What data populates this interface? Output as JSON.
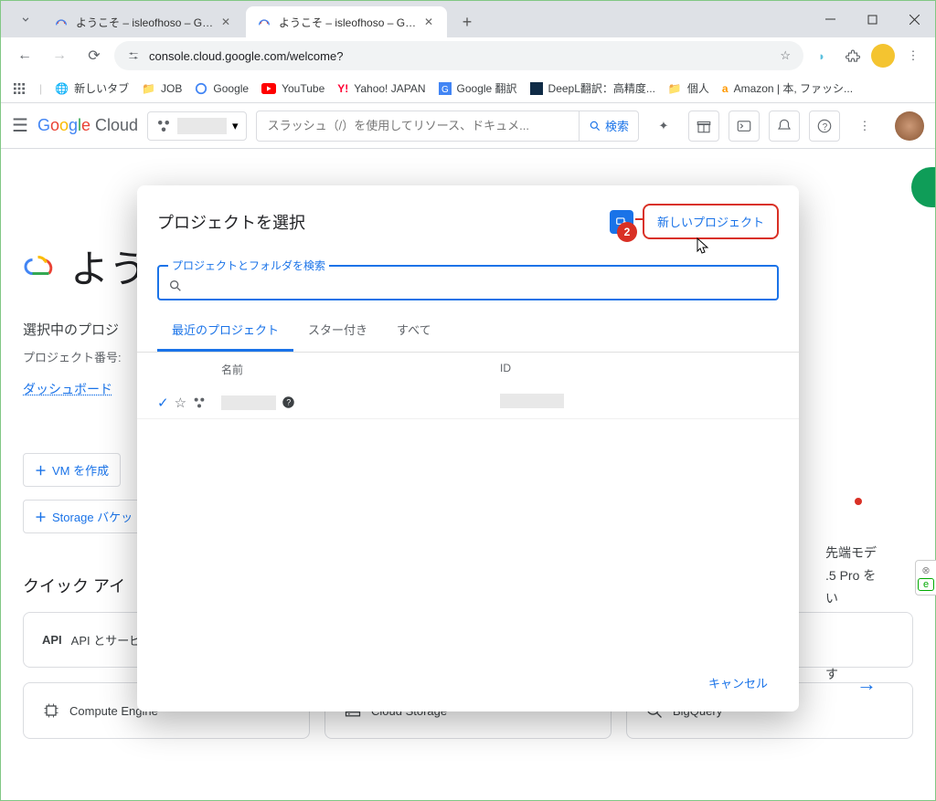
{
  "browser": {
    "tabs": [
      {
        "title": "ようこそ – isleofhoso – Google Cl"
      },
      {
        "title": "ようこそ – isleofhoso – Google Cl"
      }
    ],
    "url": "console.cloud.google.com/welcome?"
  },
  "bookmarks": {
    "newtab": "新しいタブ",
    "job": "JOB",
    "google": "Google",
    "youtube": "YouTube",
    "yahoo": "Yahoo! JAPAN",
    "gtranslate": "Google 翻訳",
    "deepl": "DeepL翻訳：高精度...",
    "personal": "個人",
    "amazon": "Amazon | 本, ファッシ..."
  },
  "gcp_header": {
    "logo_cloud": " Cloud",
    "search_placeholder": "スラッシュ（/）を使用してリソース、ドキュメ...",
    "search_btn": "検索"
  },
  "page": {
    "welcome": "よう",
    "selected_project": "選択中のプロジ",
    "project_number_label": "プロジェクト番号:",
    "dashboard_link": "ダッシュボード",
    "vm_btn": "VM を作成",
    "storage_btn": "Storage バケッ",
    "quick_access": "クイック アイ",
    "card_api": "API とサービ",
    "card_compute": "Compute Engine",
    "card_storage": "Cloud Storage",
    "card_bigquery": "BigQuery",
    "rp_l1": "先端モデ",
    "rp_l2": ".5 Pro を",
    "rp_l3": "い",
    "rp_l4": "す"
  },
  "modal": {
    "title": "プロジェクトを選択",
    "new_project_btn": "新しいプロジェクト",
    "badge_num": "2",
    "search_legend": "プロジェクトとフォルダを検索",
    "tab_recent": "最近のプロジェクト",
    "tab_starred": "スター付き",
    "tab_all": "すべて",
    "col_name": "名前",
    "col_id": "ID",
    "cancel": "キャンセル"
  }
}
